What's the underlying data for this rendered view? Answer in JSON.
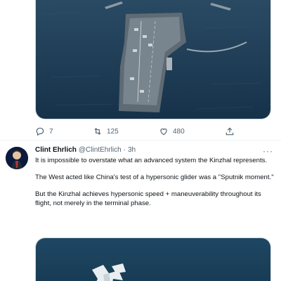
{
  "previous_tweet": {
    "image": {
      "subject": "aircraft-carrier-photo"
    },
    "actions": {
      "reply": {
        "icon": "reply-icon",
        "count": "7"
      },
      "retweet": {
        "icon": "retweet-icon",
        "count": "125"
      },
      "like": {
        "icon": "heart-icon",
        "count": "480"
      },
      "share": {
        "icon": "share-icon"
      }
    }
  },
  "tweet": {
    "author_name": "Clint Ehrlich",
    "author_handle": "@ClintEhrlich",
    "separator": "·",
    "time": "3h",
    "more": "···",
    "paragraphs": [
      "It is impossible to overstate what an advanced system the Kinzhal represents.",
      "The West acted like China's test of a hypersonic glider was a \"Sputnik moment.\"",
      "But the Kinzhal achieves hypersonic speed + maneuverability throughout its flight, not merely in the terminal phase."
    ],
    "image": {
      "subject": "aircraft-photo"
    }
  },
  "colors": {
    "text": "#0f1419",
    "muted": "#536471",
    "divider": "#eff3f4",
    "sea": "#1d3a52"
  }
}
